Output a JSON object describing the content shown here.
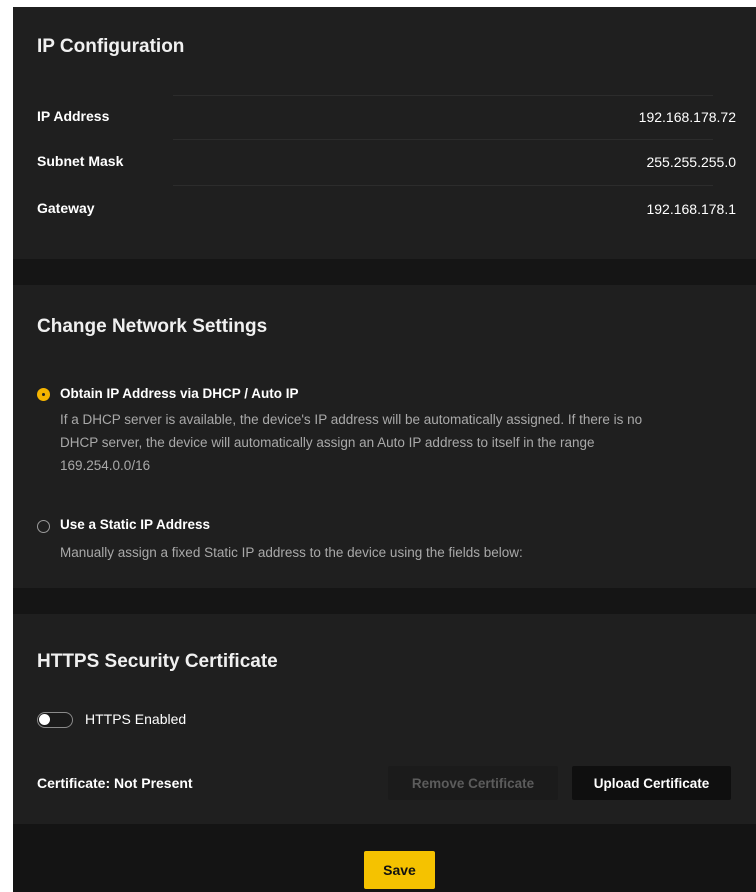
{
  "ip_config": {
    "title": "IP Configuration",
    "rows": [
      {
        "label": "IP Address",
        "value": "192.168.178.72"
      },
      {
        "label": "Subnet Mask",
        "value": "255.255.255.0"
      },
      {
        "label": "Gateway",
        "value": "192.168.178.1"
      }
    ]
  },
  "network": {
    "title": "Change Network Settings",
    "options": [
      {
        "label": "Obtain IP Address via DHCP / Auto IP",
        "selected": true,
        "desc_lines": [
          "If a DHCP server is available, the device's IP address will be automatically assigned. If there is no",
          "DHCP server, the device will automatically assign an Auto IP address to itself in the range",
          "169.254.0.0/16"
        ]
      },
      {
        "label": "Use a Static IP Address",
        "selected": false,
        "desc_lines": [
          "Manually assign a fixed Static IP address to the device using the fields below:"
        ]
      }
    ]
  },
  "https": {
    "title": "HTTPS Security Certificate",
    "toggle_label": "HTTPS Enabled",
    "toggle_on": false,
    "certificate_status": "Certificate: Not Present",
    "remove_label": "Remove Certificate",
    "upload_label": "Upload Certificate"
  },
  "footer": {
    "save_label": "Save"
  },
  "colors": {
    "accent": "#f5c200",
    "panel": "#1f1f1f",
    "background": "#151515"
  }
}
